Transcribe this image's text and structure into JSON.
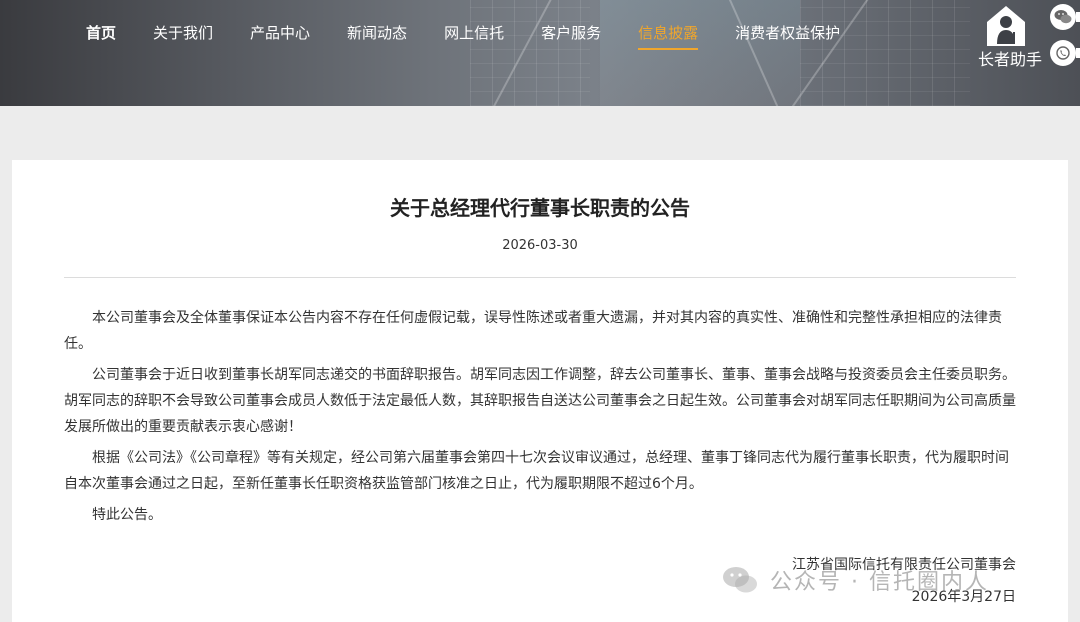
{
  "nav": {
    "items": [
      {
        "label": "首页"
      },
      {
        "label": "关于我们"
      },
      {
        "label": "产品中心"
      },
      {
        "label": "新闻动态"
      },
      {
        "label": "网上信托"
      },
      {
        "label": "客户服务"
      },
      {
        "label": "信息披露"
      },
      {
        "label": "消费者权益保护"
      }
    ],
    "active_index": 6,
    "active_color": "#f0a62c"
  },
  "elder_helper": {
    "label": "长者助手",
    "icon": "elder-person-icon"
  },
  "side_buttons": [
    {
      "icon": "wechat-icon"
    },
    {
      "icon": "phone-icon"
    }
  ],
  "article": {
    "title": "关于总经理代行董事长职责的公告",
    "date": "2026-03-30",
    "paragraphs": [
      "本公司董事会及全体董事保证本公告内容不存在任何虚假记载，误导性陈述或者重大遗漏，并对其内容的真实性、准确性和完整性承担相应的法律责任。",
      "公司董事会于近日收到董事长胡军同志递交的书面辞职报告。胡军同志因工作调整，辞去公司董事长、董事、董事会战略与投资委员会主任委员职务。胡军同志的辞职不会导致公司董事会成员人数低于法定最低人数，其辞职报告自送达公司董事会之日起生效。公司董事会对胡军同志任职期间为公司高质量发展所做出的重要贡献表示衷心感谢！",
      "根据《公司法》《公司章程》等有关规定，经公司第六届董事会第四十七次会议审议通过，总经理、董事丁锋同志代为履行董事长职责，代为履职时间自本次董事会通过之日起，至新任董事长任职资格获监管部门核准之日止，代为履职期限不超过6个月。",
      "特此公告。"
    ],
    "signature_org": "江苏省国际信托有限责任公司董事会",
    "signature_date": "2026年3月27日"
  },
  "watermark": {
    "text": "公众号 · 信托圈内人",
    "icon": "wechat-logo-icon"
  }
}
